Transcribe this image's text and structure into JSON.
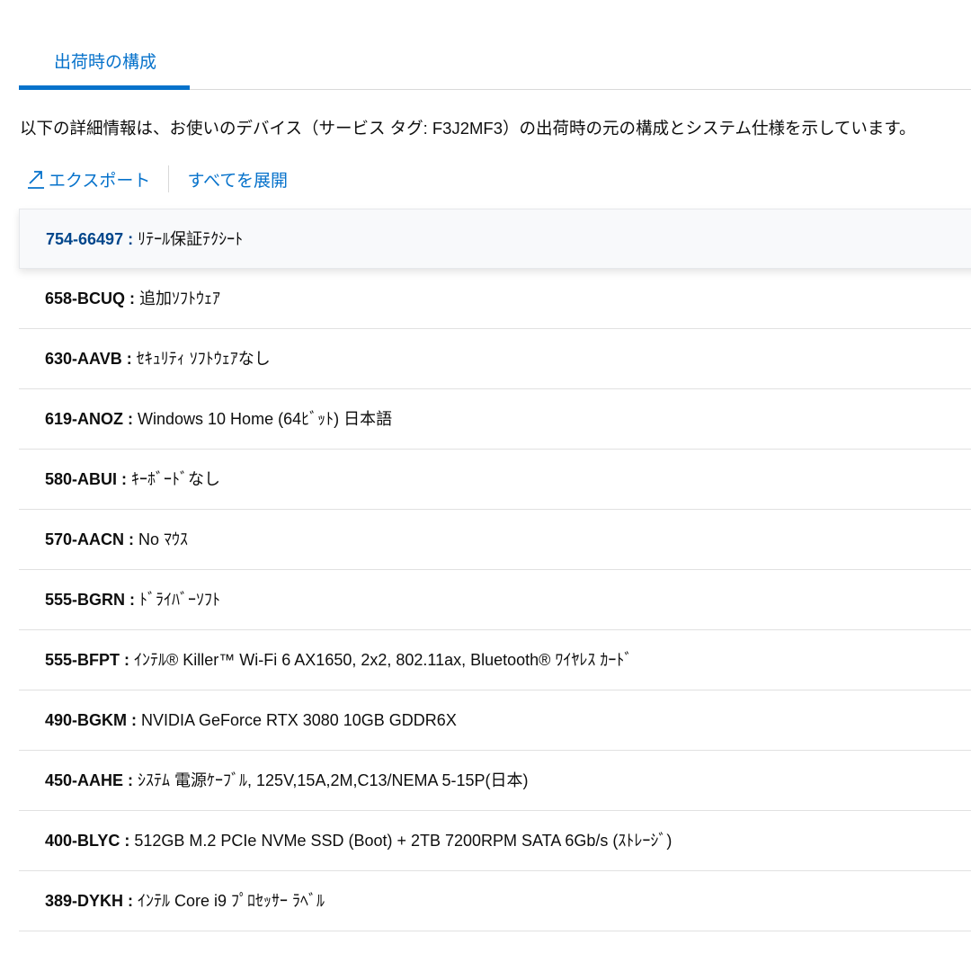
{
  "tabs": [
    {
      "label": "出荷時の構成",
      "active": true
    }
  ],
  "description": "以下の詳細情報は、お使いのデバイス（サービス タグ:  F3J2MF3）の出荷時の元の構成とシステム仕様を示しています。",
  "actions": {
    "export_label": "エクスポート",
    "expand_all_label": "すべてを展開"
  },
  "colors": {
    "accent": "#0672cb",
    "highlight_text": "#00468b"
  },
  "items": [
    {
      "part": "754-66497 :",
      "desc": " ﾘﾃｰﾙ保証ﾃｸｼｰﾄ"
    },
    {
      "part": "658-BCUQ :",
      "desc": " 追加ｿﾌﾄｳｪｱ"
    },
    {
      "part": "630-AAVB :",
      "desc": " ｾｷｭﾘﾃｨ ｿﾌﾄｳｪｱなし"
    },
    {
      "part": "619-ANOZ :",
      "desc": " Windows 10 Home (64ﾋﾞｯﾄ) 日本語"
    },
    {
      "part": "580-ABUI :",
      "desc": " ｷｰﾎﾞｰﾄﾞなし"
    },
    {
      "part": "570-AACN :",
      "desc": " No ﾏｳｽ"
    },
    {
      "part": "555-BGRN :",
      "desc": " ﾄﾞﾗｲﾊﾞｰｿﾌﾄ"
    },
    {
      "part": "555-BFPT :",
      "desc": " ｲﾝﾃﾙ® Killer™ Wi-Fi 6 AX1650, 2x2, 802.11ax, Bluetooth® ﾜｲﾔﾚｽ ｶｰﾄﾞ"
    },
    {
      "part": "490-BGKM :",
      "desc": " NVIDIA GeForce RTX 3080 10GB GDDR6X"
    },
    {
      "part": "450-AAHE :",
      "desc": " ｼｽﾃﾑ 電源ｹｰﾌﾞﾙ, 125V,15A,2M,C13/NEMA 5-15P(日本)"
    },
    {
      "part": "400-BLYC :",
      "desc": " 512GB M.2 PCIe NVMe SSD (Boot) + 2TB 7200RPM SATA 6Gb/s (ｽﾄﾚｰｼﾞ)"
    },
    {
      "part": "389-DYKH :",
      "desc": " ｲﾝﾃﾙ Core i9 ﾌﾟﾛｾｯｻｰ ﾗﾍﾞﾙ"
    }
  ]
}
